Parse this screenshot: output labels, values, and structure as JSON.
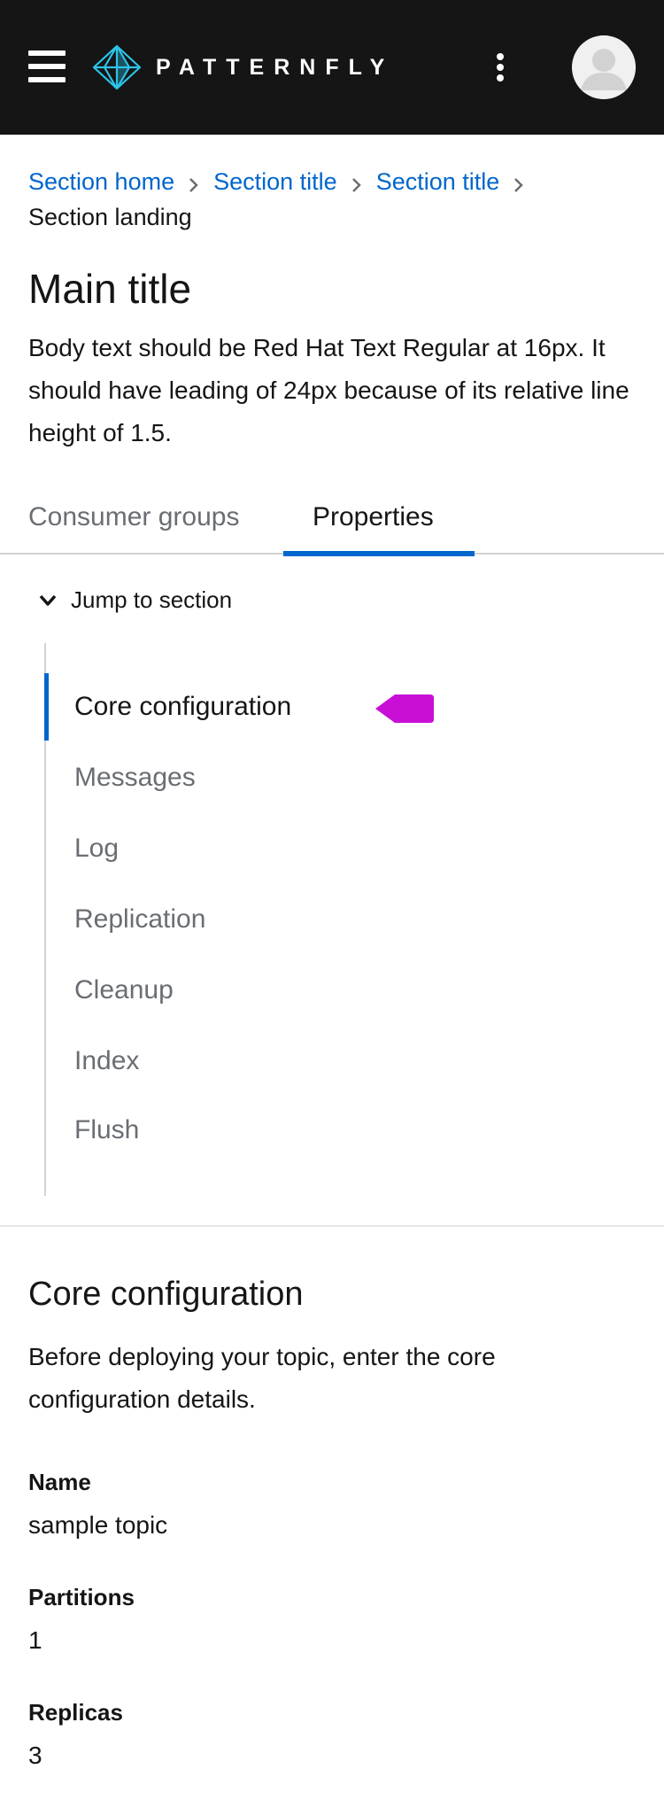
{
  "masthead": {
    "brand_text": "PATTERNFLY",
    "colors": {
      "background": "#151515",
      "logo_accent": "#2bc4e8"
    }
  },
  "breadcrumb": {
    "links": [
      "Section home",
      "Section title",
      "Section title"
    ],
    "current": "Section landing"
  },
  "page": {
    "title": "Main title",
    "body": "Body text should be Red Hat Text Regular at 16px. It should have leading of 24px because of its relative line height of 1.5."
  },
  "tabs": {
    "items": [
      {
        "label": "Consumer groups",
        "active": false
      },
      {
        "label": "Properties",
        "active": true
      }
    ]
  },
  "jump_links": {
    "toggle_label": "Jump to section",
    "items": [
      {
        "label": "Core configuration",
        "current": true
      },
      {
        "label": "Messages",
        "current": false
      },
      {
        "label": "Log",
        "current": false
      },
      {
        "label": "Replication",
        "current": false
      },
      {
        "label": "Cleanup",
        "current": false
      },
      {
        "label": "Index",
        "current": false
      },
      {
        "label": "Flush",
        "current": false
      }
    ]
  },
  "section": {
    "title": "Core configuration",
    "description": "Before deploying your topic, enter the core configuration details.",
    "fields": [
      {
        "label": "Name",
        "value": "sample topic"
      },
      {
        "label": "Partitions",
        "value": "1"
      },
      {
        "label": "Replicas",
        "value": "3"
      }
    ]
  },
  "colors": {
    "link": "#0066cc",
    "active_indicator": "#0066cc",
    "muted_text": "#6a6e73",
    "annotation_arrow": "#c90fd6"
  },
  "icons": [
    "hamburger-menu-icon",
    "patternfly-logo-icon",
    "kebab-menu-icon",
    "avatar-icon",
    "chevron-right-icon",
    "chevron-down-icon",
    "pointer-arrow-icon"
  ]
}
